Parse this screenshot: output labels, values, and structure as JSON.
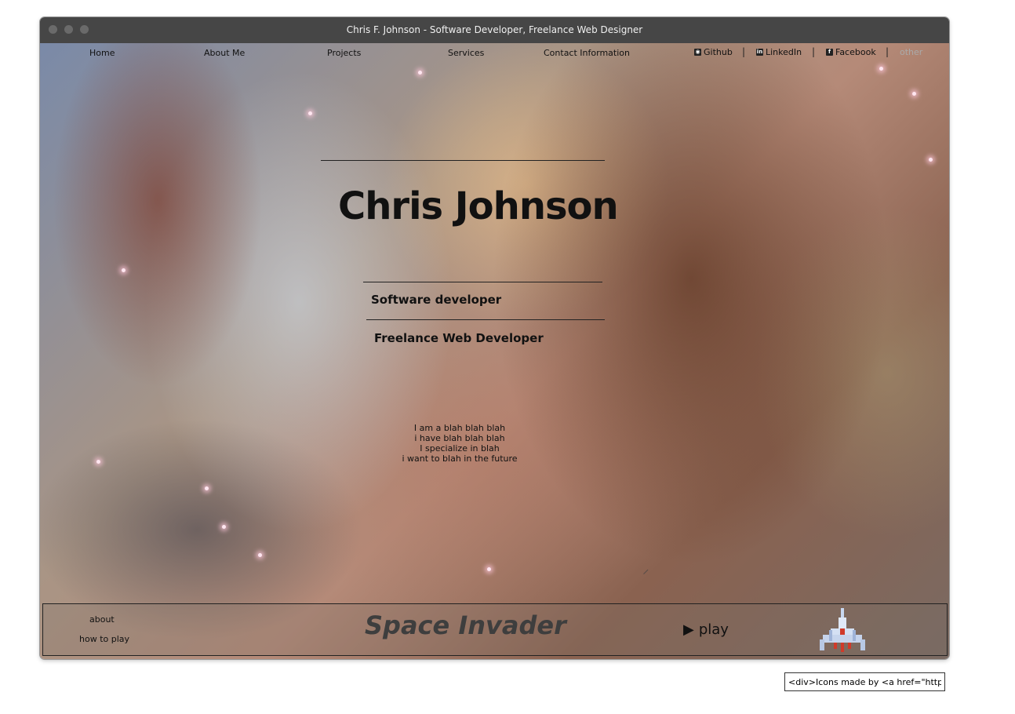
{
  "window": {
    "title": "Chris F. Johnson - Software  Developer, Freelance Web Designer"
  },
  "nav": {
    "items": [
      "Home",
      "About Me",
      "Projects",
      "Services",
      "Contact Information"
    ],
    "social": [
      {
        "label": "Github",
        "icon": "github-icon"
      },
      {
        "label": "LinkedIn",
        "icon": "linkedin-icon"
      },
      {
        "label": "Facebook",
        "icon": "facebook-icon"
      }
    ],
    "separator": "|",
    "other_label": "other"
  },
  "hero": {
    "name": "Chris Johnson",
    "role1": "Software developer",
    "role2": "Freelance Web Developer",
    "about_lines": [
      "I am a blah blah blah",
      "i have blah blah blah",
      "I specialize in blah",
      "i want to blah in the future"
    ]
  },
  "game": {
    "links": [
      "about",
      "how to play"
    ],
    "title": "Space Invader",
    "play_label": "play",
    "play_icon": "play-triangle-icon",
    "ship_icon": "spaceship-icon"
  },
  "credit": {
    "value": "<div>Icons made by <a href=\"https://www"
  },
  "colors": {
    "titlebar": "#464646",
    "title_text": "#f0f0f0",
    "game_title": "#3e3e3e",
    "other_link": "#aaaaaa"
  }
}
